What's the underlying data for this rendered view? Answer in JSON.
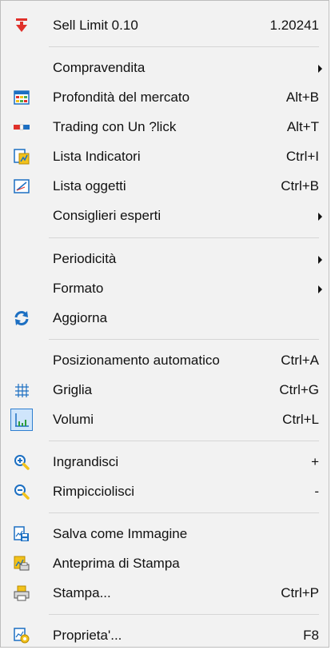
{
  "menu": {
    "items": [
      {
        "label": "Sell Limit 0.10",
        "shortcut": "1.20241",
        "icon": "sell-arrow-icon"
      },
      {
        "label": "Compravendita",
        "shortcut": "",
        "submenu": true
      },
      {
        "label": "Profondità del mercato",
        "shortcut": "Alt+B",
        "icon": "market-depth-icon"
      },
      {
        "label": "Trading con Un ?lick",
        "shortcut": "Alt+T",
        "icon": "one-click-trading-icon"
      },
      {
        "label": "Lista Indicatori",
        "shortcut": "Ctrl+I",
        "icon": "indicators-list-icon"
      },
      {
        "label": "Lista oggetti",
        "shortcut": "Ctrl+B",
        "icon": "objects-list-icon"
      },
      {
        "label": "Consiglieri esperti",
        "shortcut": "",
        "submenu": true
      },
      {
        "label": "Periodicità",
        "shortcut": "",
        "submenu": true
      },
      {
        "label": "Formato",
        "shortcut": "",
        "submenu": true
      },
      {
        "label": "Aggiorna",
        "shortcut": "",
        "icon": "refresh-icon"
      },
      {
        "label": "Posizionamento automatico",
        "shortcut": "Ctrl+A"
      },
      {
        "label": "Griglia",
        "shortcut": "Ctrl+G",
        "icon": "grid-icon"
      },
      {
        "label": "Volumi",
        "shortcut": "Ctrl+L",
        "icon": "volumes-icon",
        "checked": true
      },
      {
        "label": "Ingrandisci",
        "shortcut": "+",
        "icon": "zoom-in-icon"
      },
      {
        "label": "Rimpicciolisci",
        "shortcut": "-",
        "icon": "zoom-out-icon"
      },
      {
        "label": "Salva come Immagine",
        "shortcut": "",
        "icon": "save-image-icon"
      },
      {
        "label": "Anteprima di Stampa",
        "shortcut": "",
        "icon": "print-preview-icon"
      },
      {
        "label": "Stampa...",
        "shortcut": "Ctrl+P",
        "icon": "printer-icon"
      },
      {
        "label": "Proprieta'...",
        "shortcut": "F8",
        "icon": "properties-icon"
      }
    ]
  },
  "colors": {
    "menu_bg": "#f2f2f2",
    "separator": "#d6d6d6",
    "sell_red": "#e0302a",
    "icon_blue": "#1c6fc2",
    "icon_yellow": "#f2c21b"
  }
}
